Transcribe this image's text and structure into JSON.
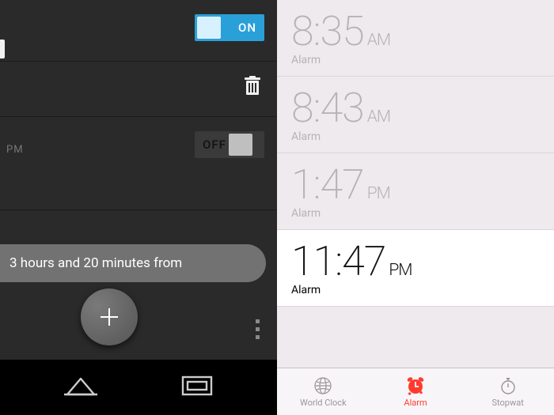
{
  "android": {
    "alarm_on_toggle": "ON",
    "alarm_off_toggle": "OFF",
    "cutoff_pm": "PM",
    "toast": "3 hours and 20 minutes from"
  },
  "ios": {
    "alarms": [
      {
        "time": "8:35",
        "ampm": "AM",
        "label": "Alarm",
        "active": false
      },
      {
        "time": "8:43",
        "ampm": "AM",
        "label": "Alarm",
        "active": false
      },
      {
        "time": "1:47",
        "ampm": "PM",
        "label": "Alarm",
        "active": false
      },
      {
        "time": "11:47",
        "ampm": "PM",
        "label": "Alarm",
        "active": true
      }
    ],
    "tabs": {
      "world_clock": "World Clock",
      "alarm": "Alarm",
      "stopwatch": "Stopwat"
    }
  }
}
